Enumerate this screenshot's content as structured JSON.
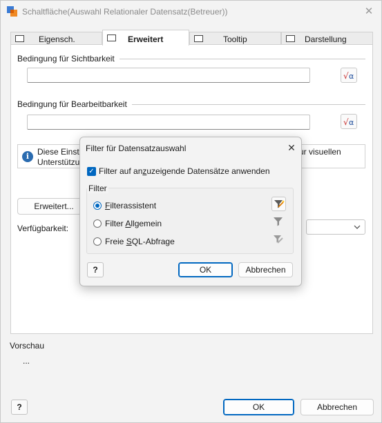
{
  "window": {
    "title": "Schaltfläche(Auswahl Relationaler Datensatz(Betreuer))",
    "close_glyph": "✕"
  },
  "tabs": [
    {
      "label": "Eigensch."
    },
    {
      "label": "Erweitert",
      "active": true
    },
    {
      "label": "Tooltip"
    },
    {
      "label": "Darstellung"
    }
  ],
  "visibility": {
    "label": "Bedingung für Sichtbarkeit",
    "value": ""
  },
  "editability": {
    "label": "Bedingung für Bearbeitbarkeit",
    "value": ""
  },
  "formula_glyph": "√α",
  "info": {
    "line1_left": "Diese Einste",
    "line2_left": "Unterstützur",
    "line1_right": "d zur visuellen"
  },
  "advanced_button": "Erweitert...",
  "availability_label": "Verfügbarkeit:",
  "preview": {
    "label": "Vorschau",
    "value": "..."
  },
  "footer": {
    "help_glyph": "?",
    "ok": "OK",
    "cancel": "Abbrechen"
  },
  "dialog": {
    "title": "Filter für Datensatzauswahl",
    "close_glyph": "✕",
    "checkbox": {
      "checked": true,
      "label_pre": "Filter auf an",
      "label_u": "z",
      "label_post": "uzeigende Datensätze anwenden"
    },
    "group_label": "Filter",
    "options": [
      {
        "pre": "",
        "u": "F",
        "post": "ilterassistent",
        "selected": true,
        "icon": "filter-wizard-icon"
      },
      {
        "pre": "Filter ",
        "u": "A",
        "post": "llgemein",
        "selected": false,
        "icon": "filter-icon"
      },
      {
        "pre": "Freie ",
        "u": "S",
        "post": "QL-Abfrage",
        "selected": false,
        "icon": "filter-edit-icon"
      }
    ],
    "help_glyph": "?",
    "ok": "OK",
    "cancel": "Abbrechen"
  },
  "colors": {
    "accent": "#0067c0",
    "window_bg": "#f3f3f3",
    "panel_bg": "#ffffff"
  }
}
